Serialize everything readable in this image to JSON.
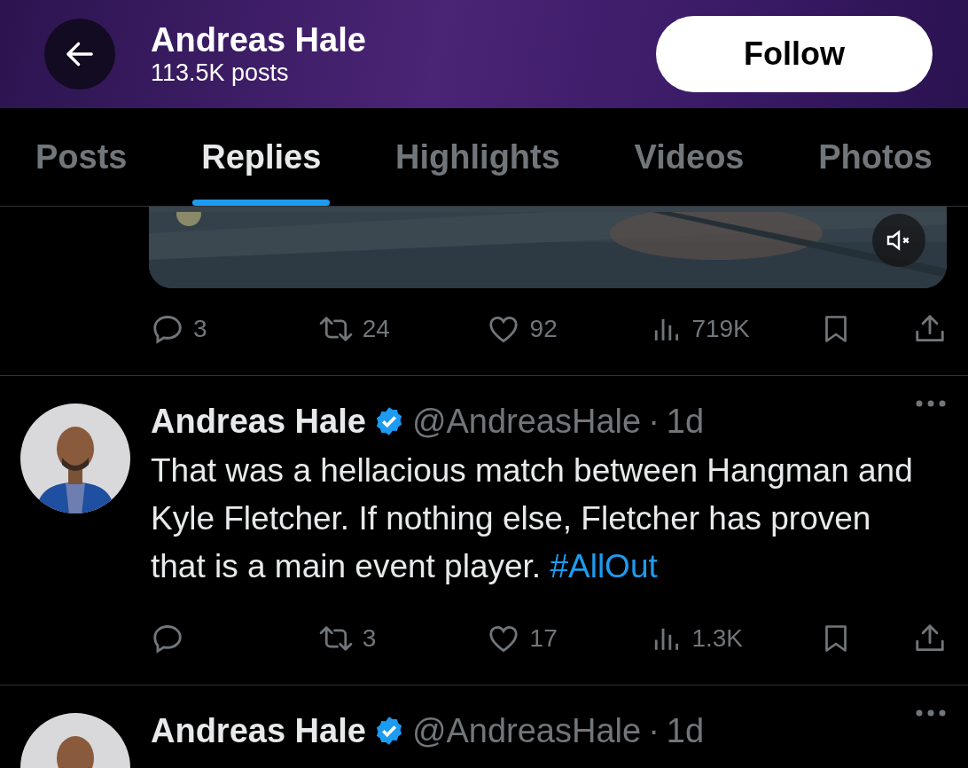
{
  "header": {
    "name": "Andreas Hale",
    "posts_count": "113.5K posts",
    "follow_button": "Follow"
  },
  "tabs": [
    {
      "label": "Posts",
      "selected": false
    },
    {
      "label": "Replies",
      "selected": true
    },
    {
      "label": "Highlights",
      "selected": false
    },
    {
      "label": "Videos",
      "selected": false
    },
    {
      "label": "Photos",
      "selected": false
    }
  ],
  "posts": [
    {
      "kind": "media",
      "media": {
        "kind": "picture",
        "muted": true
      },
      "actions": [
        {
          "kind": "reply",
          "count": "3"
        },
        {
          "kind": "repost",
          "count": "24"
        },
        {
          "kind": "like",
          "count": "92"
        },
        {
          "kind": "views",
          "count": "719K"
        },
        {
          "kind": "bookmark"
        },
        {
          "kind": "share"
        }
      ]
    },
    {
      "kind": "text",
      "author": "Andreas Hale",
      "verified": true,
      "handle": "@AndreasHale",
      "separator": "·",
      "time": "1d",
      "text": "That was a hellacious match between Hangman and Kyle Fletcher. If nothing else, Fletcher has proven that is a main event player.",
      "hashtag": "#AllOut",
      "actions": [
        {
          "kind": "reply"
        },
        {
          "kind": "repost",
          "count": "3"
        },
        {
          "kind": "like",
          "count": "17"
        },
        {
          "kind": "views",
          "count": "1.3K"
        },
        {
          "kind": "bookmark"
        },
        {
          "kind": "share"
        }
      ]
    },
    {
      "kind": "partial",
      "author": "Andreas Hale",
      "verified": true,
      "handle": "@AndreasHale",
      "separator": "·",
      "time": "1d"
    }
  ]
}
